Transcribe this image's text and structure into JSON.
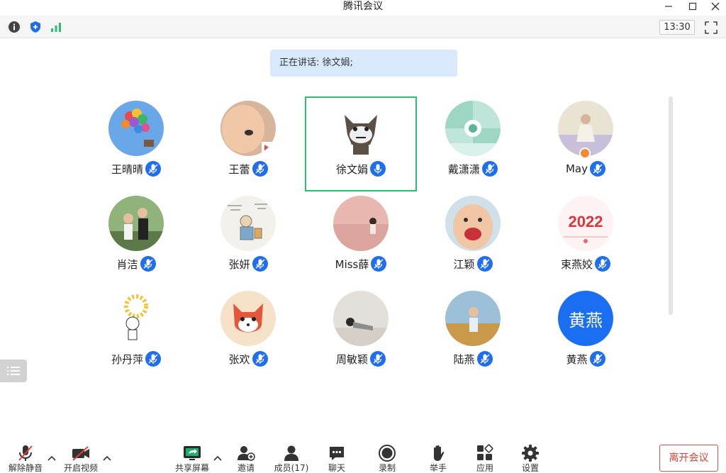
{
  "window": {
    "title": "腾讯会议"
  },
  "top_toolbar": {
    "clock": "13:30"
  },
  "speaking_banner": {
    "label": "正在讲话:",
    "speaker": "徐文娟;"
  },
  "participants": [
    {
      "name": "王晴晴",
      "avatar": "balloon-house-photo"
    },
    {
      "name": "王蕾",
      "avatar": "child-face-photo"
    },
    {
      "name": "徐文娟",
      "avatar": "cartoon-wolf",
      "active": true
    },
    {
      "name": "戴潇潇",
      "avatar": "teal-pattern"
    },
    {
      "name": "May",
      "avatar": "girl-field-photo"
    },
    {
      "name": "肖洁",
      "avatar": "family-photo"
    },
    {
      "name": "张妍",
      "avatar": "sketch-illustration"
    },
    {
      "name": "Miss薛",
      "avatar": "pink-field-photo"
    },
    {
      "name": "江颖",
      "avatar": "baby-photo"
    },
    {
      "name": "束燕姣",
      "avatar": "2022-greeting-card",
      "card_text": "2022"
    },
    {
      "name": "孙丹萍",
      "avatar": "flower-doodle"
    },
    {
      "name": "张欢",
      "avatar": "red-fox-cartoon"
    },
    {
      "name": "周敏颖",
      "avatar": "lying-child-photo"
    },
    {
      "name": "陆燕",
      "avatar": "kid-outdoor-photo"
    },
    {
      "name": "黄燕",
      "avatar": "text-avatar",
      "avatar_text": "黄燕",
      "avatar_color": "#1a6ef2"
    }
  ],
  "bottom_toolbar": {
    "unmute": "解除静音",
    "start_video": "开启视频",
    "share_screen": "共享屏幕",
    "invite": "邀请",
    "members": "成员(17)",
    "chat": "聊天",
    "record": "录制",
    "raise_hand": "举手",
    "apps": "应用",
    "settings": "设置",
    "leave": "离开会议"
  },
  "colors": {
    "accent_blue": "#1f6ef0",
    "active_border": "#2fbd74",
    "leave_red": "#e0403a",
    "banner_bg": "#d9e9fc"
  }
}
